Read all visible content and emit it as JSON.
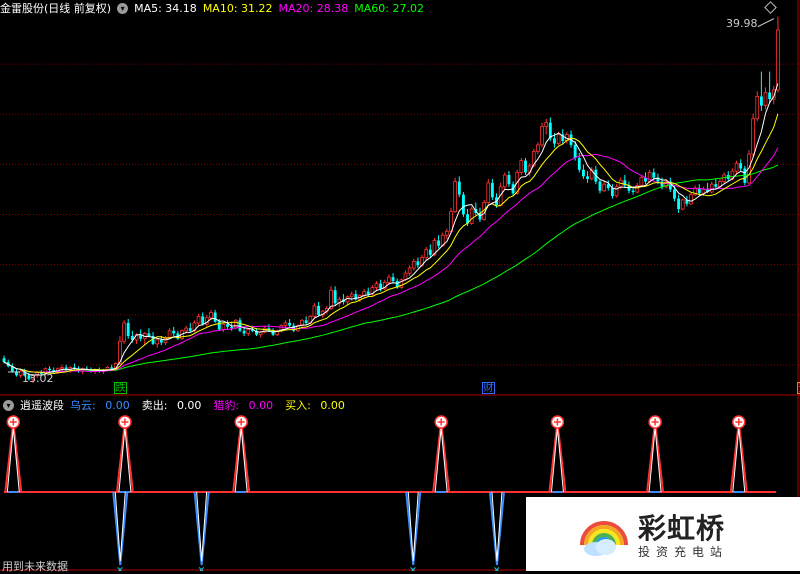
{
  "header": {
    "stock_name": "金雷股份(日线 前复权)",
    "ma": [
      {
        "label": "MA5: 34.18",
        "color": "#ffffff"
      },
      {
        "label": "MA10: 31.22",
        "color": "#ffff00"
      },
      {
        "label": "MA20: 28.38",
        "color": "#ff00ff"
      },
      {
        "label": "MA60: 27.02",
        "color": "#00ff00"
      }
    ]
  },
  "price_labels": {
    "high": "39.98",
    "low": "13.02"
  },
  "event_markers": [
    {
      "text": "跌",
      "color": "#00c000",
      "bar_index": 28
    },
    {
      "text": "财",
      "color": "#2f6bff",
      "bar_index": 117
    },
    {
      "text": "预",
      "color": "#ff7a00",
      "bar_index": 193
    }
  ],
  "indicator": {
    "name": "逍遥波段",
    "items": [
      {
        "label": "乌云:",
        "value": "0.00",
        "label_color": "#3a8cff",
        "value_color": "#3a8cff"
      },
      {
        "label": "卖出:",
        "value": "0.00",
        "label_color": "#ffffff",
        "value_color": "#ffffff"
      },
      {
        "label": "猎豹:",
        "value": "0.00",
        "label_color": "#ff00ff",
        "value_color": "#ff00ff"
      },
      {
        "label": "买入:",
        "value": "0.00",
        "label_color": "#ffff00",
        "value_color": "#ffff00"
      }
    ]
  },
  "footer_text": "用到未来数据",
  "watermark": {
    "title": "彩虹桥",
    "subtitle": "投资充电站"
  },
  "colors": {
    "up": "#ff3232",
    "down": "#00ffff",
    "grid": "#7a0000",
    "border": "#b00000"
  },
  "chart_data": {
    "type": "candlestick",
    "ylim": [
      12.4,
      41.2
    ],
    "candles": [
      [
        14.9,
        15.1,
        14.5,
        14.6
      ],
      [
        14.6,
        14.8,
        14.2,
        14.3
      ],
      [
        14.3,
        14.5,
        13.8,
        13.9
      ],
      [
        13.9,
        14.1,
        13.5,
        13.6
      ],
      [
        13.6,
        14.0,
        13.4,
        13.9
      ],
      [
        13.9,
        14.1,
        13.5,
        13.6
      ],
      [
        13.6,
        13.8,
        13.2,
        13.3
      ],
      [
        13.3,
        13.7,
        13.0,
        13.6
      ],
      [
        13.6,
        13.9,
        13.4,
        13.8
      ],
      [
        13.8,
        14.0,
        13.6,
        13.7
      ],
      [
        13.7,
        14.2,
        13.6,
        14.1
      ],
      [
        14.1,
        14.3,
        13.9,
        14.0
      ],
      [
        14.0,
        14.2,
        13.7,
        13.8
      ],
      [
        13.8,
        14.2,
        13.7,
        14.1
      ],
      [
        14.1,
        14.4,
        13.9,
        14.2
      ],
      [
        14.2,
        14.4,
        13.9,
        14.0
      ],
      [
        14.0,
        14.3,
        13.8,
        14.2
      ],
      [
        14.2,
        14.5,
        14.0,
        14.1
      ],
      [
        14.1,
        14.3,
        13.8,
        13.9
      ],
      [
        13.9,
        14.2,
        13.7,
        14.1
      ],
      [
        14.1,
        14.3,
        13.9,
        14.0
      ],
      [
        14.0,
        14.2,
        13.8,
        13.9
      ],
      [
        13.9,
        14.1,
        13.7,
        14.0
      ],
      [
        14.0,
        14.2,
        13.8,
        13.9
      ],
      [
        13.9,
        14.1,
        13.7,
        14.0
      ],
      [
        14.0,
        14.3,
        13.9,
        14.2
      ],
      [
        14.2,
        14.4,
        14.0,
        14.1
      ],
      [
        14.1,
        14.6,
        14.0,
        14.5
      ],
      [
        14.5,
        16.6,
        14.4,
        16.2
      ],
      [
        16.2,
        17.8,
        16.0,
        17.6
      ],
      [
        17.6,
        17.9,
        16.4,
        16.6
      ],
      [
        16.6,
        17.0,
        16.1,
        16.3
      ],
      [
        16.3,
        16.8,
        16.0,
        16.7
      ],
      [
        16.7,
        17.1,
        16.2,
        16.4
      ],
      [
        16.4,
        16.9,
        15.9,
        16.8
      ],
      [
        16.8,
        17.2,
        16.5,
        16.6
      ],
      [
        16.6,
        16.9,
        15.9,
        16.0
      ],
      [
        16.0,
        16.4,
        15.7,
        16.3
      ],
      [
        16.3,
        16.6,
        15.9,
        16.1
      ],
      [
        16.1,
        16.6,
        15.9,
        16.5
      ],
      [
        16.5,
        17.2,
        16.4,
        17.0
      ],
      [
        17.0,
        17.3,
        16.6,
        16.8
      ],
      [
        16.8,
        17.0,
        16.3,
        16.4
      ],
      [
        16.4,
        17.1,
        16.3,
        17.0
      ],
      [
        17.0,
        17.4,
        16.8,
        17.2
      ],
      [
        17.2,
        17.6,
        16.9,
        17.0
      ],
      [
        17.0,
        17.8,
        16.9,
        17.6
      ],
      [
        17.6,
        18.3,
        17.4,
        18.1
      ],
      [
        18.1,
        18.4,
        17.4,
        17.5
      ],
      [
        17.5,
        18.2,
        17.3,
        18.0
      ],
      [
        18.0,
        18.6,
        17.8,
        18.4
      ],
      [
        18.4,
        18.6,
        17.6,
        17.7
      ],
      [
        17.7,
        17.9,
        17.0,
        17.1
      ],
      [
        17.1,
        17.6,
        16.9,
        17.5
      ],
      [
        17.5,
        17.8,
        17.1,
        17.3
      ],
      [
        17.3,
        17.7,
        17.0,
        17.2
      ],
      [
        17.2,
        17.9,
        17.1,
        17.8
      ],
      [
        17.8,
        18.0,
        16.9,
        17.0
      ],
      [
        17.0,
        17.3,
        16.6,
        16.8
      ],
      [
        16.8,
        17.2,
        16.6,
        17.1
      ],
      [
        17.1,
        17.4,
        16.9,
        17.0
      ],
      [
        17.0,
        17.2,
        16.6,
        16.7
      ],
      [
        16.7,
        17.0,
        16.5,
        16.9
      ],
      [
        16.9,
        17.3,
        16.8,
        17.2
      ],
      [
        17.2,
        17.5,
        16.9,
        17.0
      ],
      [
        17.0,
        17.2,
        16.6,
        16.7
      ],
      [
        16.7,
        17.1,
        16.6,
        17.0
      ],
      [
        17.0,
        17.5,
        16.9,
        17.4
      ],
      [
        17.4,
        17.8,
        17.2,
        17.6
      ],
      [
        17.6,
        17.9,
        17.3,
        17.4
      ],
      [
        17.4,
        17.6,
        16.9,
        17.0
      ],
      [
        17.0,
        17.5,
        16.9,
        17.4
      ],
      [
        17.4,
        17.9,
        17.3,
        17.8
      ],
      [
        17.8,
        18.1,
        17.5,
        17.6
      ],
      [
        17.6,
        18.2,
        17.5,
        18.1
      ],
      [
        18.1,
        19.1,
        18.0,
        18.9
      ],
      [
        18.9,
        19.2,
        18.1,
        18.2
      ],
      [
        18.2,
        18.6,
        18.0,
        18.5
      ],
      [
        18.5,
        18.9,
        18.3,
        18.7
      ],
      [
        18.7,
        20.4,
        18.6,
        20.1
      ],
      [
        20.1,
        20.4,
        18.9,
        19.1
      ],
      [
        19.1,
        19.6,
        18.8,
        19.4
      ],
      [
        19.4,
        19.8,
        19.0,
        19.2
      ],
      [
        19.2,
        19.7,
        19.0,
        19.6
      ],
      [
        19.6,
        20.0,
        19.3,
        19.8
      ],
      [
        19.8,
        20.1,
        19.3,
        19.4
      ],
      [
        19.4,
        19.8,
        19.2,
        19.7
      ],
      [
        19.7,
        20.2,
        19.5,
        20.0
      ],
      [
        20.0,
        20.3,
        19.6,
        19.8
      ],
      [
        19.8,
        20.5,
        19.7,
        20.3
      ],
      [
        20.3,
        20.8,
        20.1,
        20.6
      ],
      [
        20.6,
        20.9,
        20.0,
        20.2
      ],
      [
        20.2,
        20.9,
        20.1,
        20.7
      ],
      [
        20.7,
        21.3,
        20.5,
        21.1
      ],
      [
        21.1,
        21.4,
        20.6,
        20.8
      ],
      [
        20.8,
        21.0,
        20.2,
        20.3
      ],
      [
        20.3,
        21.0,
        20.2,
        20.9
      ],
      [
        20.9,
        21.6,
        20.8,
        21.4
      ],
      [
        21.4,
        22.0,
        21.2,
        21.8
      ],
      [
        21.8,
        22.5,
        21.6,
        22.3
      ],
      [
        22.3,
        22.6,
        21.8,
        22.0
      ],
      [
        22.0,
        22.8,
        21.9,
        22.6
      ],
      [
        22.6,
        23.4,
        22.4,
        23.2
      ],
      [
        23.2,
        23.6,
        22.6,
        22.8
      ],
      [
        22.8,
        24.1,
        22.7,
        23.9
      ],
      [
        23.9,
        24.3,
        23.3,
        23.5
      ],
      [
        23.5,
        24.5,
        23.4,
        24.3
      ],
      [
        24.3,
        24.8,
        24.0,
        24.6
      ],
      [
        24.6,
        26.4,
        24.5,
        26.1
      ],
      [
        26.1,
        28.7,
        26.0,
        28.4
      ],
      [
        28.4,
        28.8,
        27.2,
        27.4
      ],
      [
        27.4,
        27.6,
        25.7,
        25.9
      ],
      [
        25.9,
        26.3,
        25.0,
        25.2
      ],
      [
        25.2,
        26.5,
        25.1,
        26.3
      ],
      [
        26.3,
        26.8,
        25.8,
        26.0
      ],
      [
        26.0,
        26.4,
        25.3,
        25.5
      ],
      [
        25.5,
        27.0,
        25.4,
        26.8
      ],
      [
        26.8,
        28.6,
        26.6,
        28.3
      ],
      [
        28.3,
        28.6,
        27.0,
        27.2
      ],
      [
        27.2,
        27.5,
        26.4,
        26.6
      ],
      [
        26.6,
        28.3,
        26.5,
        28.0
      ],
      [
        28.0,
        29.1,
        27.8,
        28.9
      ],
      [
        28.9,
        29.2,
        28.0,
        28.2
      ],
      [
        28.2,
        28.4,
        27.3,
        27.5
      ],
      [
        27.5,
        29.3,
        27.4,
        29.1
      ],
      [
        29.1,
        30.2,
        28.9,
        30.0
      ],
      [
        30.0,
        30.2,
        28.9,
        29.1
      ],
      [
        29.1,
        29.8,
        28.8,
        29.6
      ],
      [
        29.6,
        30.9,
        29.5,
        30.7
      ],
      [
        30.7,
        31.4,
        30.5,
        31.2
      ],
      [
        31.2,
        32.9,
        31.0,
        32.6
      ],
      [
        32.6,
        33.2,
        32.0,
        32.9
      ],
      [
        32.9,
        33.3,
        31.5,
        31.7
      ],
      [
        31.7,
        32.1,
        31.0,
        31.3
      ],
      [
        31.3,
        32.2,
        31.2,
        32.0
      ],
      [
        32.0,
        32.4,
        31.3,
        31.5
      ],
      [
        31.5,
        32.2,
        31.3,
        32.0
      ],
      [
        32.0,
        32.3,
        31.0,
        31.2
      ],
      [
        31.2,
        31.5,
        30.0,
        30.2
      ],
      [
        30.2,
        30.6,
        29.1,
        29.3
      ],
      [
        29.3,
        29.7,
        28.6,
        28.8
      ],
      [
        28.8,
        29.2,
        28.3,
        28.6
      ],
      [
        28.6,
        29.5,
        28.5,
        29.3
      ],
      [
        29.3,
        29.6,
        28.2,
        28.4
      ],
      [
        28.4,
        28.6,
        27.5,
        27.7
      ],
      [
        27.7,
        28.4,
        27.6,
        28.2
      ],
      [
        28.2,
        28.5,
        27.7,
        27.9
      ],
      [
        27.9,
        28.2,
        27.1,
        27.3
      ],
      [
        27.3,
        28.2,
        27.2,
        28.0
      ],
      [
        28.0,
        28.7,
        27.8,
        28.5
      ],
      [
        28.5,
        28.9,
        27.9,
        28.1
      ],
      [
        28.1,
        28.4,
        27.5,
        27.7
      ],
      [
        27.7,
        28.0,
        27.4,
        27.6
      ],
      [
        27.6,
        28.3,
        27.5,
        28.1
      ],
      [
        28.1,
        28.9,
        28.0,
        28.7
      ],
      [
        28.7,
        29.1,
        28.2,
        28.4
      ],
      [
        28.4,
        29.3,
        28.3,
        29.1
      ],
      [
        29.1,
        29.4,
        28.5,
        28.7
      ],
      [
        28.7,
        29.0,
        28.2,
        28.4
      ],
      [
        28.4,
        28.7,
        27.8,
        28.0
      ],
      [
        28.0,
        28.6,
        27.9,
        28.4
      ],
      [
        28.4,
        28.7,
        27.6,
        27.8
      ],
      [
        27.8,
        28.1,
        26.9,
        27.1
      ],
      [
        27.1,
        27.4,
        26.0,
        26.3
      ],
      [
        26.3,
        27.1,
        26.2,
        27.0
      ],
      [
        27.0,
        27.3,
        26.5,
        26.7
      ],
      [
        26.7,
        27.6,
        26.6,
        27.4
      ],
      [
        27.4,
        28.1,
        27.3,
        27.9
      ],
      [
        27.9,
        28.2,
        27.3,
        27.5
      ],
      [
        27.5,
        28.0,
        27.3,
        27.8
      ],
      [
        27.8,
        28.3,
        27.5,
        27.6
      ],
      [
        27.6,
        28.4,
        27.5,
        28.2
      ],
      [
        28.2,
        28.6,
        27.8,
        28.0
      ],
      [
        28.0,
        28.6,
        27.9,
        28.4
      ],
      [
        28.4,
        29.1,
        28.2,
        28.9
      ],
      [
        28.9,
        29.2,
        28.4,
        28.6
      ],
      [
        28.6,
        29.4,
        28.5,
        29.2
      ],
      [
        29.2,
        30.0,
        29.0,
        29.8
      ],
      [
        29.8,
        30.1,
        29.2,
        29.4
      ],
      [
        29.4,
        29.6,
        28.1,
        28.3
      ],
      [
        28.3,
        30.8,
        28.2,
        30.5
      ],
      [
        30.5,
        33.6,
        30.3,
        33.2
      ],
      [
        33.2,
        35.3,
        33.0,
        34.9
      ],
      [
        34.9,
        36.8,
        33.8,
        34.2
      ],
      [
        34.2,
        35.6,
        33.9,
        35.2
      ],
      [
        35.2,
        36.8,
        34.4,
        34.7
      ],
      [
        34.7,
        35.7,
        34.3,
        35.4
      ],
      [
        35.4,
        41.0,
        35.2,
        39.98
      ]
    ],
    "ma_colors": {
      "MA5": "#ffffff",
      "MA10": "#ffff00",
      "MA20": "#ff00ff",
      "MA60": "#00ff00"
    },
    "indicator_signals": {
      "sell_peak_bars": [
        4,
        52,
        102,
        188,
        238,
        280,
        316
      ],
      "buy_trough_bars": [
        50,
        85,
        176,
        212
      ]
    }
  }
}
